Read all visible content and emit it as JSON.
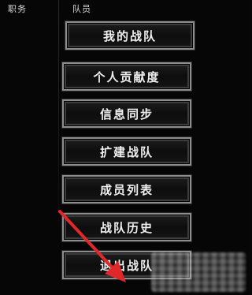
{
  "header": {
    "col_position": "职务",
    "col_member": "队员"
  },
  "menu": {
    "items": [
      {
        "label": "我的战队"
      },
      {
        "label": "个人贡献度"
      },
      {
        "label": "信息同步"
      },
      {
        "label": "扩建战队"
      },
      {
        "label": "成员列表"
      },
      {
        "label": "战队历史"
      },
      {
        "label": "退出战队"
      }
    ]
  },
  "annotation": {
    "arrow_color": "#e0282a"
  }
}
